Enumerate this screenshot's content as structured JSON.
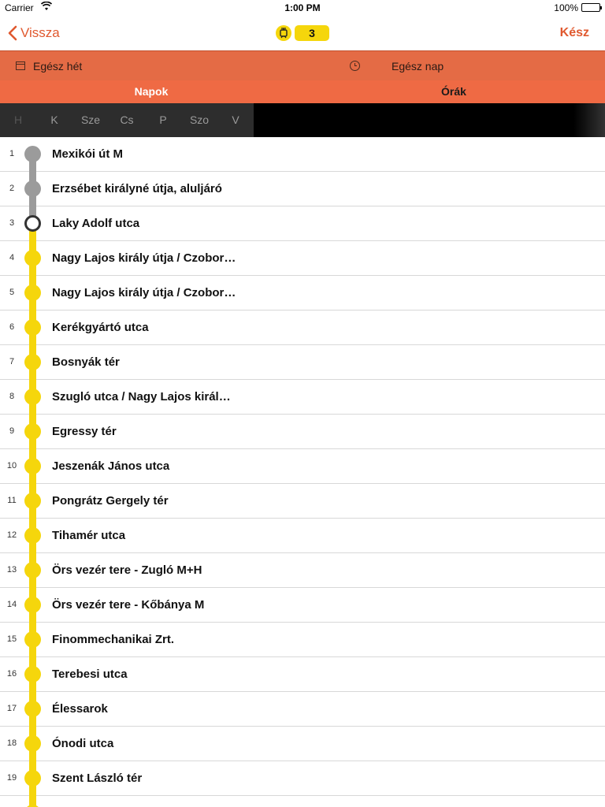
{
  "status_bar": {
    "carrier": "Carrier",
    "time": "1:00 PM",
    "battery": "100%"
  },
  "nav": {
    "back_label": "Vissza",
    "route_number": "3",
    "done_label": "Kész",
    "accent_color": "#e0592f",
    "route_color": "#f5d60c"
  },
  "filters": {
    "week_label": "Egész hét",
    "day_label": "Egész nap"
  },
  "tabs": [
    {
      "label": "Napok",
      "active": true
    },
    {
      "label": "Órák",
      "active": false
    }
  ],
  "days": [
    "H",
    "K",
    "Sze",
    "Cs",
    "P",
    "Szo",
    "V"
  ],
  "stops": [
    {
      "num": "1",
      "name": "Mexikói út M",
      "state": "passed"
    },
    {
      "num": "2",
      "name": "Erzsébet királyné útja, aluljáró",
      "state": "passed"
    },
    {
      "num": "3",
      "name": "Laky Adolf utca",
      "state": "current"
    },
    {
      "num": "4",
      "name": "Nagy Lajos király útja / Czobor…",
      "state": "upcoming"
    },
    {
      "num": "5",
      "name": "Nagy Lajos király útja / Czobor…",
      "state": "upcoming"
    },
    {
      "num": "6",
      "name": "Kerékgyártó utca",
      "state": "upcoming"
    },
    {
      "num": "7",
      "name": "Bosnyák tér",
      "state": "upcoming"
    },
    {
      "num": "8",
      "name": "Szugló utca / Nagy Lajos királ…",
      "state": "upcoming"
    },
    {
      "num": "9",
      "name": "Egressy tér",
      "state": "upcoming"
    },
    {
      "num": "10",
      "name": "Jeszenák János utca",
      "state": "upcoming"
    },
    {
      "num": "11",
      "name": "Pongrátz Gergely tér",
      "state": "upcoming"
    },
    {
      "num": "12",
      "name": "Tihamér utca",
      "state": "upcoming"
    },
    {
      "num": "13",
      "name": "Örs vezér tere - Zugló M+H",
      "state": "upcoming"
    },
    {
      "num": "14",
      "name": "Örs vezér tere - Kőbánya M",
      "state": "upcoming"
    },
    {
      "num": "15",
      "name": "Finommechanikai Zrt.",
      "state": "upcoming"
    },
    {
      "num": "16",
      "name": "Terebesi utca",
      "state": "upcoming"
    },
    {
      "num": "17",
      "name": "Élessarok",
      "state": "upcoming"
    },
    {
      "num": "18",
      "name": "Ónodi utca",
      "state": "upcoming"
    },
    {
      "num": "19",
      "name": "Szent László tér",
      "state": "upcoming"
    },
    {
      "num": "",
      "name": "",
      "state": "upcoming"
    }
  ]
}
